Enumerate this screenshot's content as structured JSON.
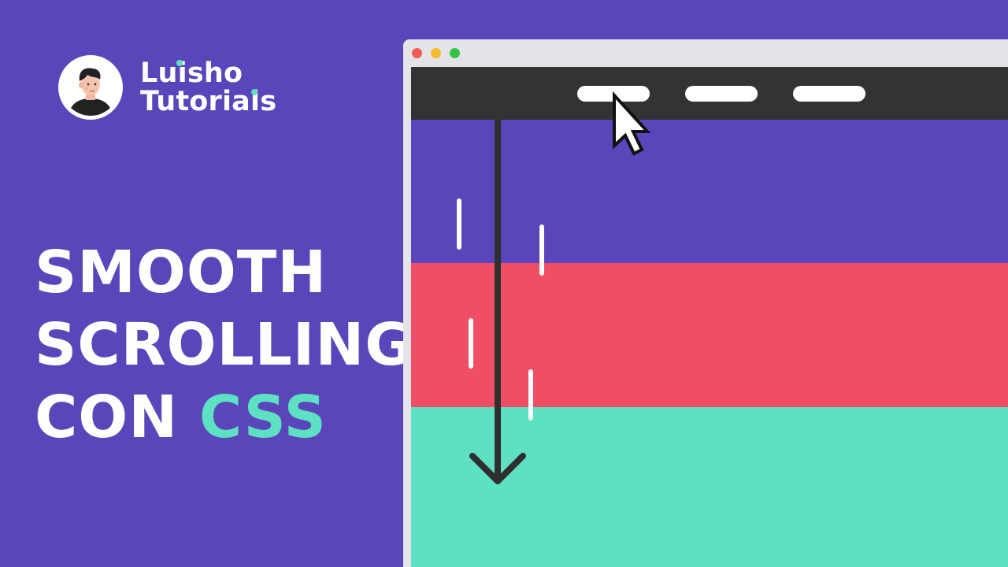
{
  "brand": {
    "line1": "Luisho",
    "line2": "Tutorials"
  },
  "headline": {
    "line1": "SMOOTH",
    "line2": "SCROLLING",
    "line3_prefix": "CON ",
    "line3_accent": "CSS"
  },
  "icons": {
    "avatar": "avatar-icon",
    "cursor": "cursor-arrow-icon",
    "scroll_arrow": "arrow-down-icon"
  },
  "colors": {
    "background": "#5b45bb",
    "accent": "#5ee0c2",
    "section_red": "#f04e66",
    "section_teal": "#5ee0c2",
    "navbar": "#333333",
    "window_close": "#f35c57",
    "window_min": "#f7bb2f",
    "window_max": "#30c443"
  }
}
